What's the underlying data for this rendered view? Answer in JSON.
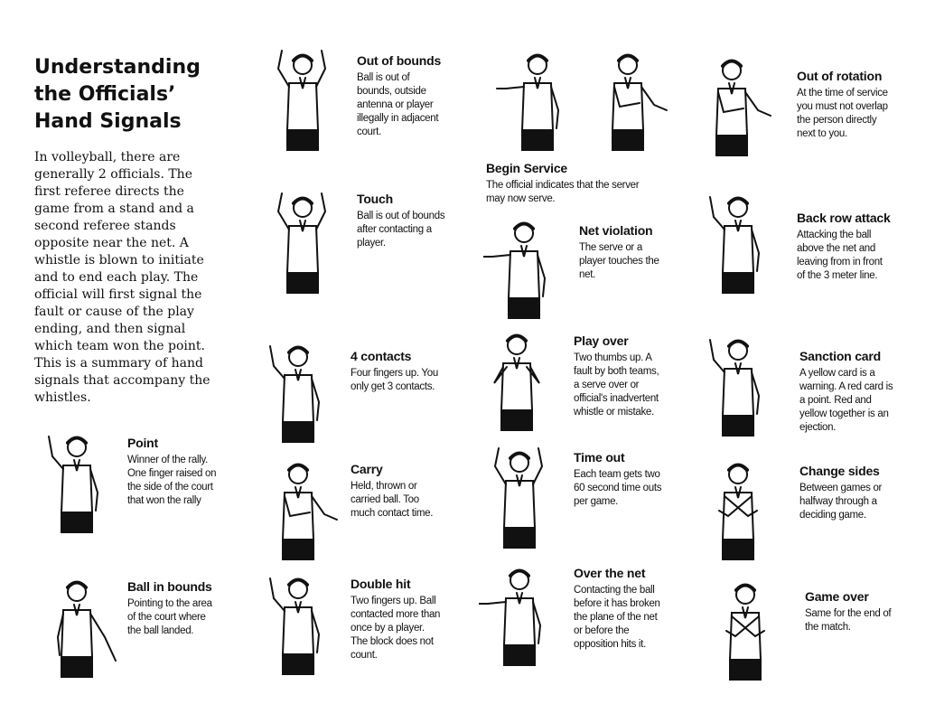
{
  "page": {
    "title_lines": [
      "Understanding",
      "the Officials’",
      "Hand Signals"
    ],
    "intro": "In volleyball, there are generally 2 officials. The first referee directs the game from a stand and a second referee stands opposite near the net. A whistle is blown to initiate and to end each play. The official will first signal the fault or cause of the play ending, and then signal which team won the point. This is a summary of hand signals that accompany the whistles."
  },
  "signals": {
    "point": {
      "title": "Point",
      "desc": "Winner of the rally. One finger raised on the side of the court that won the rally"
    },
    "ball_in_bounds": {
      "title": "Ball in bounds",
      "desc": "Pointing to the area of the court where the ball landed."
    },
    "out_of_bounds": {
      "title": "Out of bounds",
      "desc": "Ball is out of bounds, outside antenna or player illegally in adjacent court."
    },
    "touch": {
      "title": "Touch",
      "desc": "Ball is out of bounds after contacting a player."
    },
    "four_contacts": {
      "title": "4 contacts",
      "desc": "Four fingers up. You only get 3 contacts."
    },
    "carry": {
      "title": "Carry",
      "desc": "Held, thrown or carried ball. Too much contact time."
    },
    "double_hit": {
      "title": "Double hit",
      "desc": "Two fingers up. Ball contacted more than once by a player. The block does not count."
    },
    "begin_service": {
      "title": "Begin Service",
      "desc": "The official indicates that the server may now serve."
    },
    "net_violation": {
      "title": "Net violation",
      "desc": "The serve or a player touches the net."
    },
    "play_over": {
      "title": "Play over",
      "desc": "Two thumbs up. A fault by both teams, a serve over or official's inadvertent whistle or mistake."
    },
    "time_out": {
      "title": "Time out",
      "desc": "Each team gets two 60 second time outs per game."
    },
    "over_the_net": {
      "title": "Over the net",
      "desc": "Contacting the ball before it has broken the plane of the net or before the opposition hits it."
    },
    "out_of_rotation": {
      "title": "Out of rotation",
      "desc": "At the time of service you must not overlap the person directly next to you."
    },
    "back_row_attack": {
      "title": "Back row attack",
      "desc": "Attacking the ball above the net and leaving from in front of the 3 meter line."
    },
    "sanction_card": {
      "title": "Sanction card",
      "desc": "A yellow card is a warning. A red card is a point. Red and yellow together is an ejection."
    },
    "change_sides": {
      "title": "Change sides",
      "desc": "Between games or halfway through a deciding game."
    },
    "game_over": {
      "title": "Game over",
      "desc": "Same for the end of the match."
    }
  },
  "illustrations": {
    "point": "referee-one-finger-up",
    "ball_in_bounds": "referee-pointing-down",
    "out_of_bounds": "referee-arms-raised",
    "touch": "referee-hand-over-fingers",
    "four_contacts": "referee-four-fingers",
    "carry": "referee-palm-lift",
    "double_hit": "referee-two-fingers",
    "begin_service": "referees-beckon-serve",
    "net_violation": "referee-touch-net",
    "play_over": "referee-thumbs-up",
    "time_out": "referee-t-hands",
    "over_the_net": "referee-hand-over-net",
    "out_of_rotation": "referee-circle-motion",
    "back_row_attack": "referee-arm-up-down",
    "sanction_card": "referee-holding-card",
    "change_sides": "referee-rotating-arms",
    "game_over": "referee-crossed-arms"
  }
}
